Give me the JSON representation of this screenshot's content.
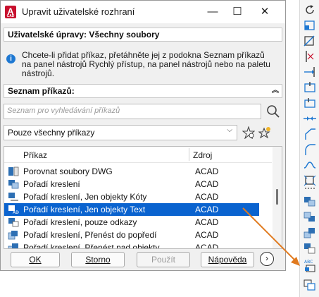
{
  "dialog": {
    "app_icon_letter": "A",
    "app_icon_sub": "CAD",
    "title": "Upravit uživatelské rozhraní",
    "window_buttons": {
      "minimize": "—",
      "maximize": "☐",
      "close": "✕"
    }
  },
  "customizations_header": "Uživatelské úpravy: Všechny soubory",
  "info_text": "Chcete-li přidat příkaz, přetáhněte jej z podokna Seznam příkazů na panel nástrojů Rychlý přístup, na panel nástrojů nebo na paletu nástrojů.",
  "commands_header": "Seznam příkazů:",
  "search": {
    "placeholder": "Seznam pro vyhledávání příkazů"
  },
  "filter": {
    "selected": "Pouze všechny příkazy"
  },
  "list": {
    "columns": {
      "command": "Příkaz",
      "source": "Zdroj"
    },
    "rows": [
      {
        "name": "Porovnat soubory DWG",
        "source": "ACAD",
        "selected": false
      },
      {
        "name": "Pořadí kreslení",
        "source": "ACAD",
        "selected": false
      },
      {
        "name": "Pořadí kreslení, Jen objekty Kóty",
        "source": "ACAD",
        "selected": false
      },
      {
        "name": "Pořadí kreslení, Jen objekty Text",
        "source": "ACAD",
        "selected": true
      },
      {
        "name": "Pořadí kreslení, pouze odkazy",
        "source": "ACAD",
        "selected": false
      },
      {
        "name": "Pořadí kreslení, Přenést do popředí",
        "source": "ACAD",
        "selected": false
      },
      {
        "name": "Pořadí kreslení, Přenést nad objekty",
        "source": "ACAD",
        "selected": false
      }
    ]
  },
  "buttons": {
    "ok": "OK",
    "cancel": "Storno",
    "apply": "Použít",
    "help": "Nápověda",
    "next": "›"
  },
  "colors": {
    "selection": "#0a63cf",
    "arrow": "#e07a1f",
    "accent": "#1e78d2"
  }
}
